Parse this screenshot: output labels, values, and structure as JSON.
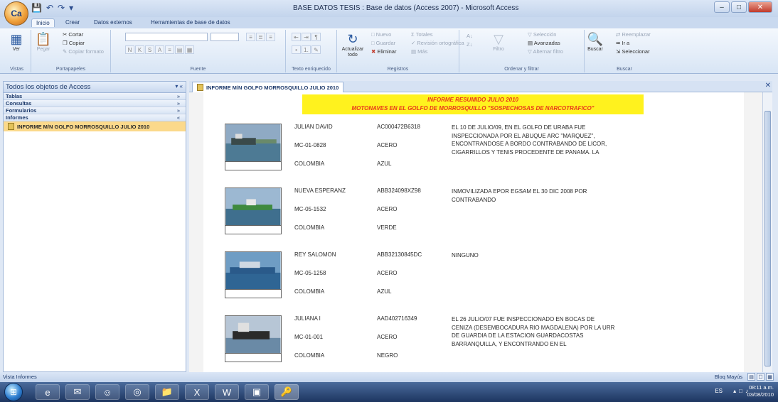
{
  "window": {
    "title": "BASE DATOS TESIS : Base de datos (Access 2007) - Microsoft Access",
    "office_button": "Ca",
    "controls": [
      "–",
      "□",
      "✕"
    ]
  },
  "ribbon_tabs": [
    "Inicio",
    "Crear",
    "Datos externos",
    "Herramientas de base de datos"
  ],
  "ribbon": {
    "ver": "Ver",
    "pegar": "Pegar",
    "cortar": "Cortar",
    "copiar": "Copiar",
    "copiar_formato": "Copiar formato",
    "actualizar": "Actualizar todo",
    "nuevo": "Nuevo",
    "totales": "Totales",
    "guardar": "Guardar",
    "revision": "Revisión ortográfica",
    "eliminar": "Eliminar",
    "mas": "Más",
    "filtro": "Filtro",
    "seleccion": "Selección",
    "avanzadas": "Avanzadas",
    "alternar": "Alternar filtro",
    "buscar": "Buscar",
    "reemplazar": "Reemplazar",
    "ir_a": "Ir a",
    "seleccionar": "Seleccionar",
    "groups": {
      "vistas": "Vistas",
      "portapapeles": "Portapapeles",
      "fuente": "Fuente",
      "texto": "Texto enriquecido",
      "registros": "Registros",
      "ordenar": "Ordenar y filtrar",
      "buscar": "Buscar"
    }
  },
  "nav": {
    "header": "Todos los objetos de Access",
    "categories": [
      "Tablas",
      "Consultas",
      "Formularios",
      "Informes"
    ],
    "selected_item": "INFORME M/N GOLFO MORROSQUILLO JULIO 2010"
  },
  "doc_tab": "INFORME M/N GOLFO MORROSQUILLO JULIO 2010",
  "report": {
    "title_line1": "INFORME RESUMIDO JULIO 2010",
    "title_line2": "MOTONAVES EN EL GOLFO DE MORROSQUILLO \"SOSPECHOSAS DE NARCOTRAFICO\"",
    "records": [
      {
        "name": "JULIAN DAVID",
        "code": "AC000472B6318",
        "registration": "MC-01-0828",
        "material": "ACERO",
        "flag": "COLOMBIA",
        "color": "AZUL",
        "description": "EL 10 DE JULIO/09, EN EL GOLFO DE URABA FUE INSPECCIONADA POR EL ABUQUE ARC \"MARQUEZ\", ENCONTRANDOSE A BORDO CONTRABANDO DE LICOR, CIGARRILLOS Y TENIS PROCEDENTE DE PANAMA. LA"
      },
      {
        "name": "NUEVA ESPERANZ",
        "code": "ABB324098XZ98",
        "registration": "MC-05-1532",
        "material": "ACERO",
        "flag": "COLOMBIA",
        "color": "VERDE",
        "description": "INMOVILIZADA EPOR EGSAM EL 30 DIC 2008 POR CONTRABANDO"
      },
      {
        "name": "REY SALOMON",
        "code": "ABB32130845DC",
        "registration": "MC-05-1258",
        "material": "ACERO",
        "flag": "COLOMBIA",
        "color": "AZUL",
        "description": "NINGUNO"
      },
      {
        "name": "JULIANA I",
        "code": "AAD402716349",
        "registration": "MC-01-001",
        "material": "ACERO",
        "flag": "COLOMBIA",
        "color": "NEGRO",
        "description": "EL 26 JULIO/07 FUE INSPECCIONADO EN BOCAS DE CENIZA (DESEMBOCADURA RIO MAGDALENA) POR LA URR DE GUARDIA DE LA ESTACION GUARDACOSTAS BARRANQUILLA, Y ENCONTRANDO EN EL"
      }
    ]
  },
  "status": {
    "left": "Vista Informes",
    "right": "Bloq Mayús"
  },
  "taskbar": {
    "lang": "ES",
    "time": "08:11 a.m.",
    "date": "03/08/2010"
  }
}
